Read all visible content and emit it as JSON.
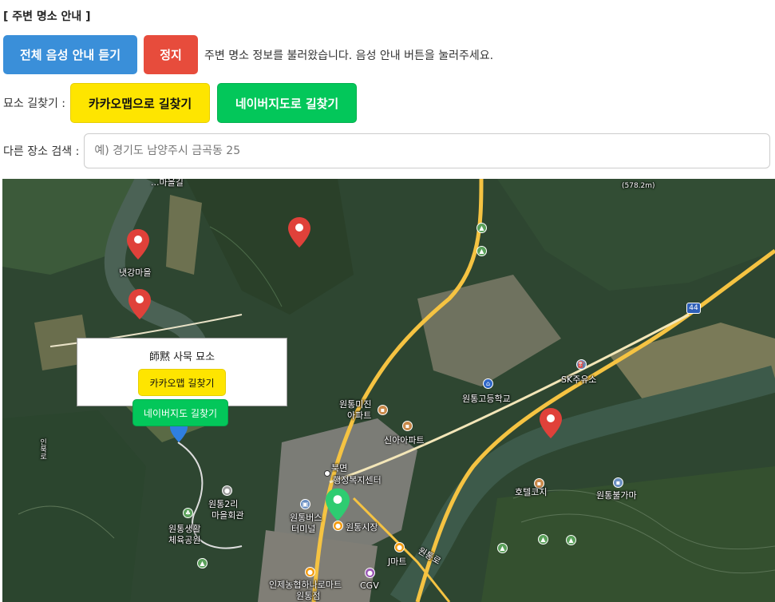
{
  "header": {
    "title": "[ 주변 명소 안내 ]"
  },
  "audio": {
    "play_all_label": "전체 음성 안내 듣기",
    "stop_label": "정지",
    "status": "주변 명소 정보를 불러왔습니다. 음성 안내 버튼을 눌러주세요."
  },
  "directions": {
    "label": "묘소 길찾기 :",
    "kakao_label": "카카오맵으로 길찾기",
    "naver_label": "네이버지도로 길찾기"
  },
  "search": {
    "label": "다른 장소 검색 :",
    "placeholder": "예) 경기도 남양주시 금곡동 25"
  },
  "map": {
    "popup": {
      "title": "師黙 사묵 묘소",
      "kakao_label": "카카오맵 길찾기",
      "naver_label": "네이버지도 길찾기"
    },
    "labels": {
      "naegang": "냇강마을",
      "village_top": "...마을길",
      "elevation": "(578.2m)",
      "sk_station": "SK주유소",
      "school": "원통고등학교",
      "apt_mijin_1": "원통미진",
      "apt_mijin_2": "아파트",
      "apt_sina": "신아아파트",
      "bukmyeon_1": "북면",
      "bukmyeon_2": "행정복지센터",
      "hall_1": "원통2리",
      "hall_2": "마을회관",
      "park_1": "원통생활",
      "park_2": "체육공원",
      "terminal_1": "원통버스",
      "terminal_2": "터미널",
      "market": "원통시장",
      "jmart": "J마트",
      "hanaro_1": "인제농협하나로마트",
      "hanaro_2": "원통점",
      "cgv": "CGV",
      "hotel": "호텔코지",
      "bulgama": "원통불가마",
      "road_name": "원통로",
      "road_num": "44",
      "side_road": "인북로"
    },
    "colors": {
      "pin_red": "#e0413a",
      "pin_green": "#2ecc71",
      "pin_blue": "#2f7fe0",
      "road": "#f5c342",
      "river": "#3d5a4a"
    }
  }
}
